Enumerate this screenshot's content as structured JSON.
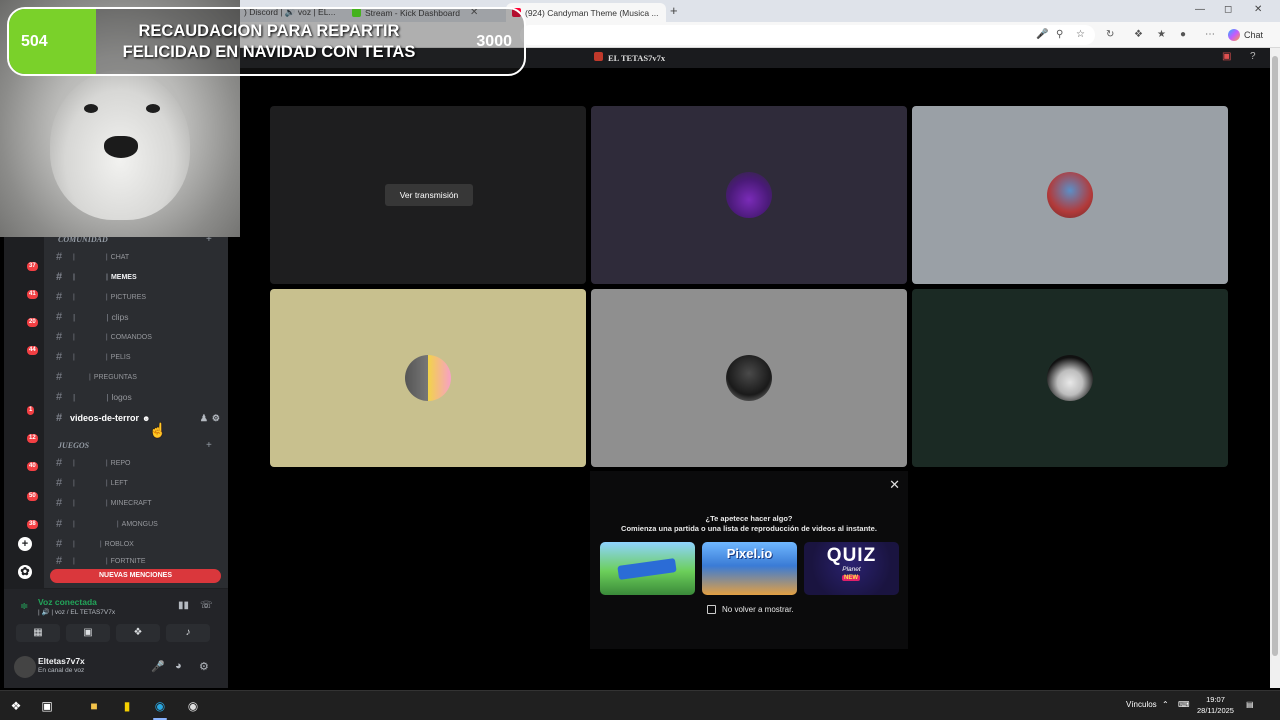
{
  "browser": {
    "tabs": [
      {
        "label": ") Discord | 🔊 voz | EL...",
        "close": "✕"
      },
      {
        "label": "Stream - Kick Dashboard",
        "close": "✕"
      },
      {
        "label": "(924) Candyman Theme (Musica ...",
        "close": "✕"
      }
    ],
    "new_tab": "+",
    "chat_label": "Chat"
  },
  "overlay": {
    "current": "504",
    "goal": "3000",
    "progress_fraction": 0.168,
    "title": "RECAUDACION PARA REPARTIR FELICIDAD EN NAVIDAD CON TETAS"
  },
  "discord": {
    "server_name": "EL TETAS7v7x",
    "guilds": [
      {
        "badge": "37",
        "color": "#a35a3a"
      },
      {
        "badge": "41",
        "color": "#e08a1c"
      },
      {
        "badge": "20",
        "color": "#6b3fa0"
      },
      {
        "badge": "44",
        "color": "#b03a2e"
      },
      {
        "badge": "",
        "color": "#c0392b"
      },
      {
        "badge": "1",
        "color": "#8a8a8a"
      },
      {
        "badge": "12",
        "color": "#e8e8e8"
      },
      {
        "badge": "40",
        "color": "#7e3fd6"
      },
      {
        "badge": "50",
        "color": "#b8323a"
      },
      {
        "badge": "38",
        "color": "#7b7b7b"
      }
    ],
    "categories": {
      "comunidad": "COMUNIDAD",
      "juegos": "JUEGOS"
    },
    "channels": [
      {
        "name": "CHAT",
        "color": "#d0d0d0",
        "bold": false
      },
      {
        "name": "MEMES",
        "color": "#f5c542",
        "bold": true
      },
      {
        "name": "PICTURES",
        "color": "#c9a66b",
        "bold": false
      },
      {
        "name": "clips",
        "color": "#8a8ad6",
        "bold": false
      },
      {
        "name": "COMANDOS",
        "color": "#bbbbbb",
        "bold": false
      },
      {
        "name": "PELIS",
        "color": "#aaaaaa",
        "bold": false
      },
      {
        "name": "PREGUNTAS",
        "color": "#e53935",
        "bold": false
      },
      {
        "name": "logos",
        "color": "#d8c07a",
        "bold": false
      }
    ],
    "selected_channel": "videos-de-terror",
    "game_channels": [
      {
        "name": "REPO",
        "color": "#c9a66b"
      },
      {
        "name": "LEFT",
        "color": "#43b581"
      },
      {
        "name": "MINECRAFT",
        "color": "#5a9e3a"
      },
      {
        "name": "AMONGUS",
        "color": "#e5a23a"
      },
      {
        "name": "ROBLOX",
        "color": "#3aa3d6"
      },
      {
        "name": "FORTNITE",
        "color": "#7a9a3a"
      }
    ],
    "new_mentions": "NUEVAS MENCIONES",
    "voice": {
      "title": "Voz conectada",
      "subtitle": "| 🔊 | voz / EL TETAS7V7x"
    },
    "user": {
      "name": "Eltetas7v7x",
      "status": "En canal de voz"
    },
    "stage": {
      "watch_stream": "Ver transmisión",
      "tiles": [
        {
          "bg": "#1e1e1f",
          "avatar_color": ""
        },
        {
          "bg": "#2f2b3a",
          "avatar_color": "#7a2bb8"
        },
        {
          "bg": "#9aa0a6",
          "avatar_color": "#b23a3a"
        },
        {
          "bg": "#c8c08e",
          "avatar_color": "#f2d34a"
        },
        {
          "bg": "#8f8f8f",
          "avatar_color": "#2a2a2a"
        },
        {
          "bg": "#1b2a24",
          "avatar_color": "#e8e8e8"
        }
      ]
    },
    "activity": {
      "close": "✕",
      "question": "¿Te apetece hacer algo?",
      "subtitle": "Comienza una partida o una lista de reproducción de videos al instante.",
      "games": [
        {
          "label": "",
          "color": "#4fb34f"
        },
        {
          "label": "Pixel.io",
          "color": "#3a7bd5"
        },
        {
          "label": "QUIZ",
          "color": "#1a1440"
        }
      ],
      "quiz_sub": "Planet",
      "quiz_badge": "NEW",
      "dont_show": "No volver a mostrar."
    }
  },
  "taskbar": {
    "links": "Vínculos",
    "time": "19:07",
    "date": "28/11/2025"
  }
}
